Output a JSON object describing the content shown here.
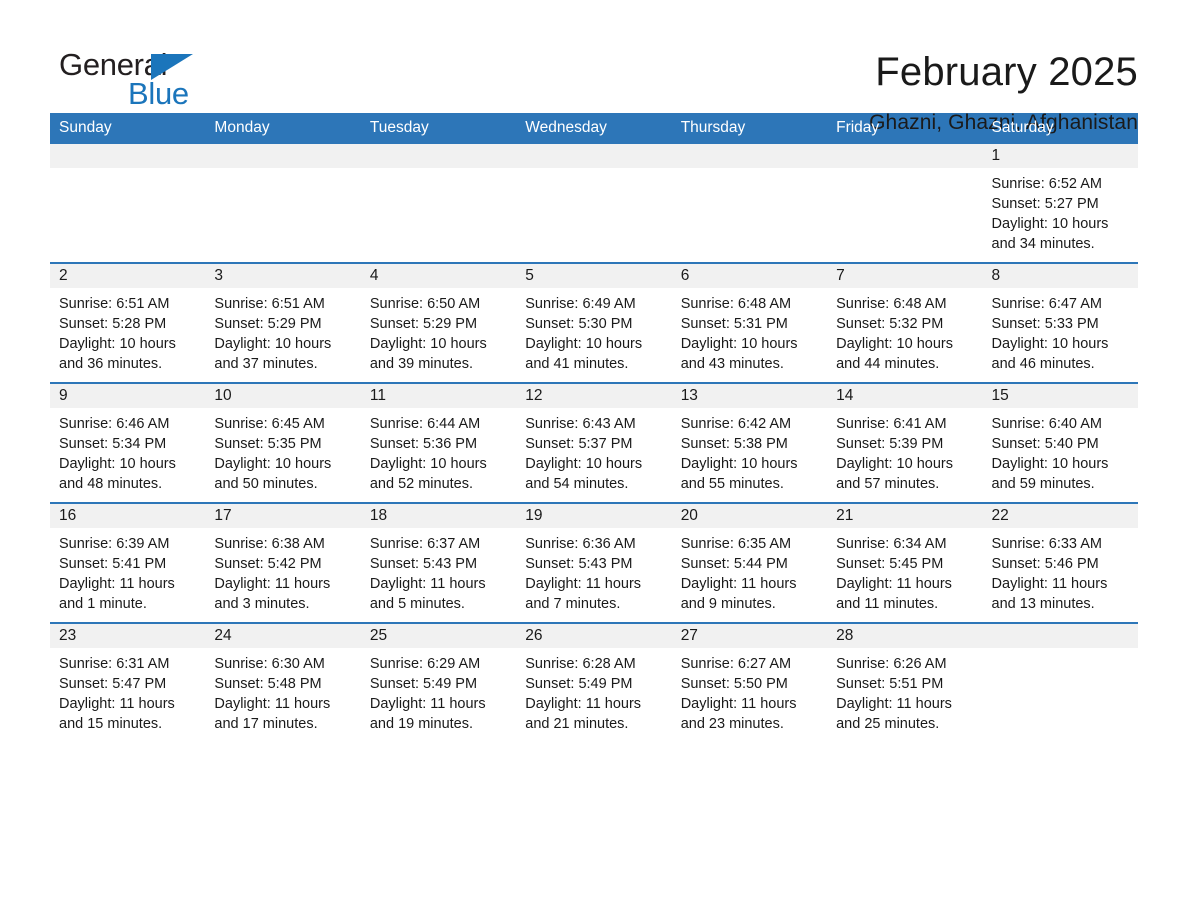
{
  "brand": {
    "name_part1": "General",
    "name_part2": "Blue",
    "accent_color": "#1b75bb",
    "triangle_icon": "triangle-icon"
  },
  "header": {
    "title": "February 2025",
    "subtitle": "Ghazni, Ghazni, Afghanistan"
  },
  "calendar": {
    "header_bg": "#2d76b8",
    "daynum_bg": "#f1f1f1",
    "weekday_headers": [
      "Sunday",
      "Monday",
      "Tuesday",
      "Wednesday",
      "Thursday",
      "Friday",
      "Saturday"
    ],
    "weeks": [
      [
        {
          "day": "",
          "blank": true,
          "sunrise": "",
          "sunset": "",
          "daylight_line1": "",
          "daylight_line2": ""
        },
        {
          "day": "",
          "blank": true,
          "sunrise": "",
          "sunset": "",
          "daylight_line1": "",
          "daylight_line2": ""
        },
        {
          "day": "",
          "blank": true,
          "sunrise": "",
          "sunset": "",
          "daylight_line1": "",
          "daylight_line2": ""
        },
        {
          "day": "",
          "blank": true,
          "sunrise": "",
          "sunset": "",
          "daylight_line1": "",
          "daylight_line2": ""
        },
        {
          "day": "",
          "blank": true,
          "sunrise": "",
          "sunset": "",
          "daylight_line1": "",
          "daylight_line2": ""
        },
        {
          "day": "",
          "blank": true,
          "sunrise": "",
          "sunset": "",
          "daylight_line1": "",
          "daylight_line2": ""
        },
        {
          "day": "1",
          "blank": false,
          "sunrise": "Sunrise: 6:52 AM",
          "sunset": "Sunset: 5:27 PM",
          "daylight_line1": "Daylight: 10 hours",
          "daylight_line2": "and 34 minutes."
        }
      ],
      [
        {
          "day": "2",
          "blank": false,
          "sunrise": "Sunrise: 6:51 AM",
          "sunset": "Sunset: 5:28 PM",
          "daylight_line1": "Daylight: 10 hours",
          "daylight_line2": "and 36 minutes."
        },
        {
          "day": "3",
          "blank": false,
          "sunrise": "Sunrise: 6:51 AM",
          "sunset": "Sunset: 5:29 PM",
          "daylight_line1": "Daylight: 10 hours",
          "daylight_line2": "and 37 minutes."
        },
        {
          "day": "4",
          "blank": false,
          "sunrise": "Sunrise: 6:50 AM",
          "sunset": "Sunset: 5:29 PM",
          "daylight_line1": "Daylight: 10 hours",
          "daylight_line2": "and 39 minutes."
        },
        {
          "day": "5",
          "blank": false,
          "sunrise": "Sunrise: 6:49 AM",
          "sunset": "Sunset: 5:30 PM",
          "daylight_line1": "Daylight: 10 hours",
          "daylight_line2": "and 41 minutes."
        },
        {
          "day": "6",
          "blank": false,
          "sunrise": "Sunrise: 6:48 AM",
          "sunset": "Sunset: 5:31 PM",
          "daylight_line1": "Daylight: 10 hours",
          "daylight_line2": "and 43 minutes."
        },
        {
          "day": "7",
          "blank": false,
          "sunrise": "Sunrise: 6:48 AM",
          "sunset": "Sunset: 5:32 PM",
          "daylight_line1": "Daylight: 10 hours",
          "daylight_line2": "and 44 minutes."
        },
        {
          "day": "8",
          "blank": false,
          "sunrise": "Sunrise: 6:47 AM",
          "sunset": "Sunset: 5:33 PM",
          "daylight_line1": "Daylight: 10 hours",
          "daylight_line2": "and 46 minutes."
        }
      ],
      [
        {
          "day": "9",
          "blank": false,
          "sunrise": "Sunrise: 6:46 AM",
          "sunset": "Sunset: 5:34 PM",
          "daylight_line1": "Daylight: 10 hours",
          "daylight_line2": "and 48 minutes."
        },
        {
          "day": "10",
          "blank": false,
          "sunrise": "Sunrise: 6:45 AM",
          "sunset": "Sunset: 5:35 PM",
          "daylight_line1": "Daylight: 10 hours",
          "daylight_line2": "and 50 minutes."
        },
        {
          "day": "11",
          "blank": false,
          "sunrise": "Sunrise: 6:44 AM",
          "sunset": "Sunset: 5:36 PM",
          "daylight_line1": "Daylight: 10 hours",
          "daylight_line2": "and 52 minutes."
        },
        {
          "day": "12",
          "blank": false,
          "sunrise": "Sunrise: 6:43 AM",
          "sunset": "Sunset: 5:37 PM",
          "daylight_line1": "Daylight: 10 hours",
          "daylight_line2": "and 54 minutes."
        },
        {
          "day": "13",
          "blank": false,
          "sunrise": "Sunrise: 6:42 AM",
          "sunset": "Sunset: 5:38 PM",
          "daylight_line1": "Daylight: 10 hours",
          "daylight_line2": "and 55 minutes."
        },
        {
          "day": "14",
          "blank": false,
          "sunrise": "Sunrise: 6:41 AM",
          "sunset": "Sunset: 5:39 PM",
          "daylight_line1": "Daylight: 10 hours",
          "daylight_line2": "and 57 minutes."
        },
        {
          "day": "15",
          "blank": false,
          "sunrise": "Sunrise: 6:40 AM",
          "sunset": "Sunset: 5:40 PM",
          "daylight_line1": "Daylight: 10 hours",
          "daylight_line2": "and 59 minutes."
        }
      ],
      [
        {
          "day": "16",
          "blank": false,
          "sunrise": "Sunrise: 6:39 AM",
          "sunset": "Sunset: 5:41 PM",
          "daylight_line1": "Daylight: 11 hours",
          "daylight_line2": "and 1 minute."
        },
        {
          "day": "17",
          "blank": false,
          "sunrise": "Sunrise: 6:38 AM",
          "sunset": "Sunset: 5:42 PM",
          "daylight_line1": "Daylight: 11 hours",
          "daylight_line2": "and 3 minutes."
        },
        {
          "day": "18",
          "blank": false,
          "sunrise": "Sunrise: 6:37 AM",
          "sunset": "Sunset: 5:43 PM",
          "daylight_line1": "Daylight: 11 hours",
          "daylight_line2": "and 5 minutes."
        },
        {
          "day": "19",
          "blank": false,
          "sunrise": "Sunrise: 6:36 AM",
          "sunset": "Sunset: 5:43 PM",
          "daylight_line1": "Daylight: 11 hours",
          "daylight_line2": "and 7 minutes."
        },
        {
          "day": "20",
          "blank": false,
          "sunrise": "Sunrise: 6:35 AM",
          "sunset": "Sunset: 5:44 PM",
          "daylight_line1": "Daylight: 11 hours",
          "daylight_line2": "and 9 minutes."
        },
        {
          "day": "21",
          "blank": false,
          "sunrise": "Sunrise: 6:34 AM",
          "sunset": "Sunset: 5:45 PM",
          "daylight_line1": "Daylight: 11 hours",
          "daylight_line2": "and 11 minutes."
        },
        {
          "day": "22",
          "blank": false,
          "sunrise": "Sunrise: 6:33 AM",
          "sunset": "Sunset: 5:46 PM",
          "daylight_line1": "Daylight: 11 hours",
          "daylight_line2": "and 13 minutes."
        }
      ],
      [
        {
          "day": "23",
          "blank": false,
          "sunrise": "Sunrise: 6:31 AM",
          "sunset": "Sunset: 5:47 PM",
          "daylight_line1": "Daylight: 11 hours",
          "daylight_line2": "and 15 minutes."
        },
        {
          "day": "24",
          "blank": false,
          "sunrise": "Sunrise: 6:30 AM",
          "sunset": "Sunset: 5:48 PM",
          "daylight_line1": "Daylight: 11 hours",
          "daylight_line2": "and 17 minutes."
        },
        {
          "day": "25",
          "blank": false,
          "sunrise": "Sunrise: 6:29 AM",
          "sunset": "Sunset: 5:49 PM",
          "daylight_line1": "Daylight: 11 hours",
          "daylight_line2": "and 19 minutes."
        },
        {
          "day": "26",
          "blank": false,
          "sunrise": "Sunrise: 6:28 AM",
          "sunset": "Sunset: 5:49 PM",
          "daylight_line1": "Daylight: 11 hours",
          "daylight_line2": "and 21 minutes."
        },
        {
          "day": "27",
          "blank": false,
          "sunrise": "Sunrise: 6:27 AM",
          "sunset": "Sunset: 5:50 PM",
          "daylight_line1": "Daylight: 11 hours",
          "daylight_line2": "and 23 minutes."
        },
        {
          "day": "28",
          "blank": false,
          "sunrise": "Sunrise: 6:26 AM",
          "sunset": "Sunset: 5:51 PM",
          "daylight_line1": "Daylight: 11 hours",
          "daylight_line2": "and 25 minutes."
        },
        {
          "day": "",
          "blank": true,
          "sunrise": "",
          "sunset": "",
          "daylight_line1": "",
          "daylight_line2": ""
        }
      ]
    ]
  }
}
